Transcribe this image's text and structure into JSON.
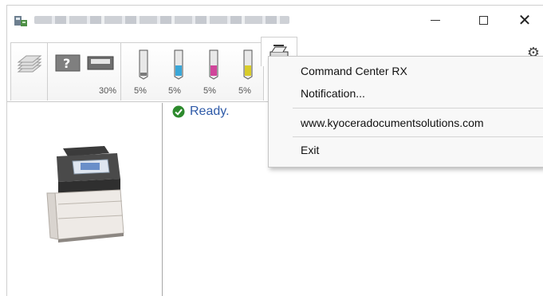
{
  "window": {
    "controls": {
      "minimize": "minimize",
      "maximize": "maximize",
      "close": "close"
    }
  },
  "toolbar": {
    "duplex_percent": "30%",
    "toners": [
      {
        "label": "5%",
        "color": "#7a7a7a"
      },
      {
        "label": "5%",
        "color": "#3aa7d8"
      },
      {
        "label": "5%",
        "color": "#d0459a"
      },
      {
        "label": "5%",
        "color": "#d8cc2a"
      }
    ],
    "settings_icon": "gear-icon",
    "fax_icon": "fax-icon"
  },
  "status": {
    "text": "Ready.",
    "color": "#2e5aa8",
    "icon": "check-circle-icon"
  },
  "context_menu": {
    "items": [
      {
        "label": "Command Center RX"
      },
      {
        "label": "Notification..."
      },
      {
        "label": "www.kyoceradocumentsolutions.com"
      },
      {
        "label": "Exit"
      }
    ]
  }
}
